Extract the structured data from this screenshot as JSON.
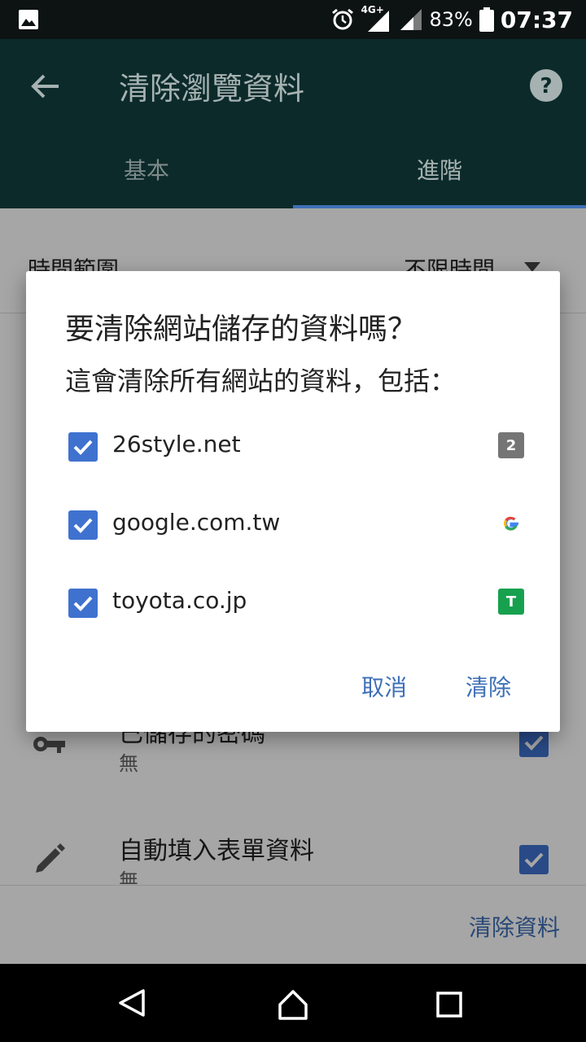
{
  "status_bar": {
    "network": "4G+",
    "battery_text": "83%",
    "time": "07:37"
  },
  "app_bar": {
    "title": "清除瀏覽資料",
    "tabs": [
      {
        "label": "基本",
        "active": false
      },
      {
        "label": "進階",
        "active": true
      }
    ]
  },
  "background": {
    "time_range_label": "時間範圍",
    "time_range_value": "不限時間",
    "items": [
      {
        "title": "已儲存的密碼",
        "sub": "無",
        "checked": true,
        "icon": "key-icon"
      },
      {
        "title": "自動填入表單資料",
        "sub": "無",
        "checked": true,
        "icon": "pencil-icon"
      }
    ],
    "clear_button": "清除資料"
  },
  "dialog": {
    "title": "要清除網站儲存的資料嗎？",
    "subtitle": "這會清除所有網站的資料，包括：",
    "sites": [
      {
        "name": "26style.net",
        "favicon_text": "2",
        "favicon": "gray-badge",
        "checked": true
      },
      {
        "name": "google.com.tw",
        "favicon_text": "G",
        "favicon": "google-icon",
        "checked": true
      },
      {
        "name": "toyota.co.jp",
        "favicon_text": "T",
        "favicon": "green-badge",
        "checked": true
      }
    ],
    "cancel_label": "取消",
    "confirm_label": "清除"
  },
  "colors": {
    "accent": "#3e6fb7",
    "checkbox": "#3f72cf",
    "app_bar": "#0c2a2a"
  }
}
